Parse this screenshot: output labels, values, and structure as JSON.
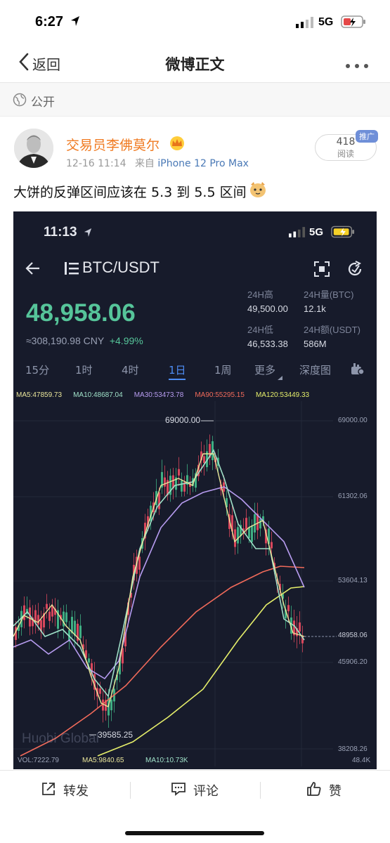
{
  "status": {
    "time": "6:27",
    "network": "5G"
  },
  "nav": {
    "back_label": "返回",
    "title": "微博正文"
  },
  "visibility": {
    "label": "公开"
  },
  "post": {
    "author": "交易员李佛莫尔",
    "date": "12-16 11:14",
    "source_prefix": "来自",
    "device": "iPhone 12 Pro Max",
    "text": "大饼的反弹区间应该在 5.3 到 5.5 区间",
    "reads_count": "418",
    "reads_label": "阅读",
    "promo_tag": "推广"
  },
  "screenshot": {
    "status": {
      "time": "11:13",
      "network": "5G"
    },
    "pair": "BTC/USDT",
    "price": "48,958.06",
    "price_cny": "≈308,190.98 CNY",
    "change": "+4.99%",
    "stats": [
      {
        "label": "24H高",
        "value": "49,500.00"
      },
      {
        "label": "24H量(BTC)",
        "value": "12.1k"
      },
      {
        "label": "24H低",
        "value": "46,533.38"
      },
      {
        "label": "24H额(USDT)",
        "value": "586M"
      }
    ],
    "timeframes": [
      "15分",
      "1时",
      "4时",
      "1日",
      "1周",
      "更多",
      "深度图"
    ],
    "active_timeframe": "1日",
    "ma_legend": [
      {
        "label": "MA5:47859.73",
        "color": "#e9e59a"
      },
      {
        "label": "MA10:48687.04",
        "color": "#9fe0c8"
      },
      {
        "label": "MA30:53473.78",
        "color": "#b79cf0"
      },
      {
        "label": "MA90:55295.15",
        "color": "#f06a5a"
      },
      {
        "label": "MA120:53449.33",
        "color": "#e5ee6a"
      }
    ],
    "price_axis": [
      "69000.00",
      "61302.06",
      "53604.13",
      "48958.06",
      "45906.20",
      "38208.26"
    ],
    "high_marker": "69000.00",
    "low_marker": "39585.25",
    "watermark": "Huobi Global",
    "volume": {
      "vol": "VOL:7222.79",
      "ma5": "MA5:9840.65",
      "ma10": "MA10:10.73K",
      "axis": "48.4K"
    }
  },
  "actions": {
    "repost": "转发",
    "comment": "评论",
    "like": "赞"
  }
}
